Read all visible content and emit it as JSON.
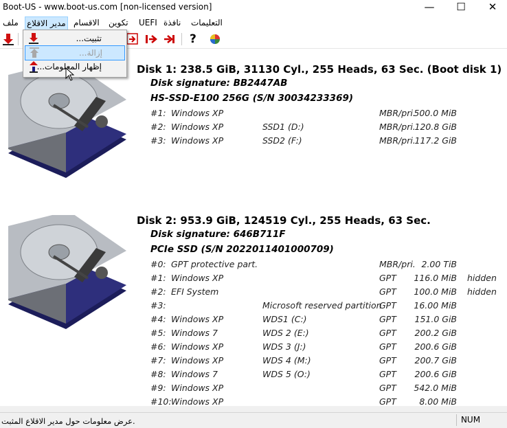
{
  "window": {
    "title": "Boot-US - www.boot-us.com  [non-licensed version]",
    "min": "—",
    "max": "☐",
    "close": "✕"
  },
  "menu": {
    "file": "ملف",
    "bootmgr": "مدير الاقلاع",
    "partitions": "الاقسام",
    "config": "تكوين",
    "uefi": "UEFI",
    "window": "نافذة",
    "help": "التعليمات"
  },
  "dropdown": {
    "install": "تثبيت...",
    "remove": "إزالة...",
    "info": "إظهار المعلومات..."
  },
  "disks": [
    {
      "header": "Disk 1:  238.5 GiB,  31130 Cyl., 255 Heads, 63 Sec. (Boot disk 1)",
      "signature": "Disk signature:  BB2447AB",
      "model": "HS-SSD-E100 256G  (S/N 30034233369)",
      "partitions": [
        {
          "num": "#1:",
          "os": "Windows XP",
          "label": "",
          "type": "MBR/pri.",
          "size": "500.0 MiB",
          "flag": ""
        },
        {
          "num": "#2:",
          "os": "Windows XP",
          "label": "SSD1 (D:)",
          "type": "MBR/pri.",
          "size": "120.8 GiB",
          "flag": ""
        },
        {
          "num": "#3:",
          "os": "Windows XP",
          "label": "SSD2 (F:)",
          "type": "MBR/pri.",
          "size": "117.2 GiB",
          "flag": ""
        }
      ]
    },
    {
      "header": "Disk 2:  953.9 GiB,  124519 Cyl., 255 Heads, 63 Sec.",
      "signature": "Disk signature:  646B711F",
      "model": "PCIe SSD  (S/N 2022011401000709)",
      "partitions": [
        {
          "num": "#0:",
          "os": "GPT protective part.",
          "label": "",
          "type": "MBR/pri.",
          "size": "2.00 TiB",
          "flag": ""
        },
        {
          "num": "#1:",
          "os": "Windows XP",
          "label": "",
          "type": "GPT",
          "size": "116.0 MiB",
          "flag": "hidden"
        },
        {
          "num": "#2:",
          "os": "EFI System",
          "label": "",
          "type": "GPT",
          "size": "100.0 MiB",
          "flag": "hidden"
        },
        {
          "num": "#3:",
          "os": "",
          "label": "Microsoft reserved partition",
          "type": "GPT",
          "size": "16.00 MiB",
          "flag": ""
        },
        {
          "num": "#4:",
          "os": "Windows XP",
          "label": "WDS1 (C:)",
          "type": "GPT",
          "size": "151.0 GiB",
          "flag": ""
        },
        {
          "num": "#5:",
          "os": "Windows 7",
          "label": "WDS 2 (E:)",
          "type": "GPT",
          "size": "200.2 GiB",
          "flag": ""
        },
        {
          "num": "#6:",
          "os": "Windows XP",
          "label": "WDS 3 (J:)",
          "type": "GPT",
          "size": "200.6 GiB",
          "flag": ""
        },
        {
          "num": "#7:",
          "os": "Windows XP",
          "label": "WDS 4 (M:)",
          "type": "GPT",
          "size": "200.7 GiB",
          "flag": ""
        },
        {
          "num": "#8:",
          "os": "Windows 7",
          "label": "WDS 5 (O:)",
          "type": "GPT",
          "size": "200.6 GiB",
          "flag": ""
        },
        {
          "num": "#9:",
          "os": "Windows XP",
          "label": "",
          "type": "GPT",
          "size": "542.0 MiB",
          "flag": ""
        },
        {
          "num": "#10:",
          "os": "Windows XP",
          "label": "",
          "type": "GPT",
          "size": "8.00 MiB",
          "flag": ""
        }
      ]
    }
  ],
  "status": {
    "text": "عرض معلومات حول مدير الاقلاع المثبت.",
    "num": "NUM"
  },
  "toolbar": {
    "help": "?"
  },
  "icons": [
    "install-icon",
    "remove-icon",
    "info-icon",
    "help-icon",
    "color-icon"
  ]
}
